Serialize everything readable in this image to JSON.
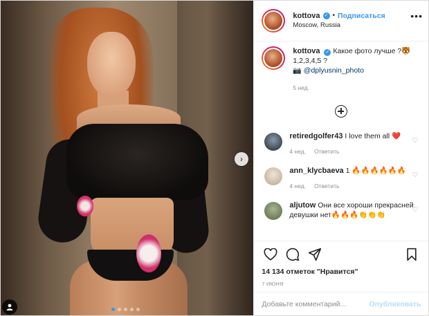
{
  "post": {
    "author": {
      "username": "kottova",
      "location": "Moscow, Russia",
      "follow_label": "Подписаться",
      "separator": "•"
    },
    "caption": {
      "username": "kottova",
      "text": "Какое фото лучше ?🐯 1,2,3,4,5 ?",
      "camera_emoji": "📷",
      "mention": "@dplyusnin_photo",
      "time": "5 нед."
    },
    "comments": [
      {
        "username": "retiredgolfer43",
        "text": "I love them all ❤️",
        "time": "4 нед.",
        "reply_label": "Ответить",
        "avatar_color": "#3e4a55"
      },
      {
        "username": "ann_klycbaeva",
        "text": "1 🔥🔥🔥🔥🔥🔥",
        "time": "4 нед.",
        "reply_label": "Ответить",
        "avatar_color": "#c9b8a2"
      },
      {
        "username": "aljutow",
        "text": "Они все хороши прекрасней девушки нет🔥🔥🔥👏👏👏",
        "time": "",
        "reply_label": "",
        "avatar_color": "#6f7d5c"
      }
    ],
    "likes_text": "14 134 отметок \"Нравится\"",
    "date": "7 ИЮНЯ",
    "add_comment": {
      "placeholder": "Добавьте комментарий...",
      "publish_label": "Опубликовать"
    },
    "carousel": {
      "count": 5,
      "active_index": 0
    },
    "colors": {
      "accent": "#3897f0",
      "text": "#262626",
      "muted": "#8e8e8e",
      "publish_disabled": "#b2dffc"
    },
    "icons": [
      "more-icon",
      "verified-icon",
      "plus-circle-icon",
      "heart-icon",
      "comment-icon",
      "share-icon",
      "bookmark-icon",
      "next-arrow-icon",
      "user-tag-icon"
    ]
  }
}
